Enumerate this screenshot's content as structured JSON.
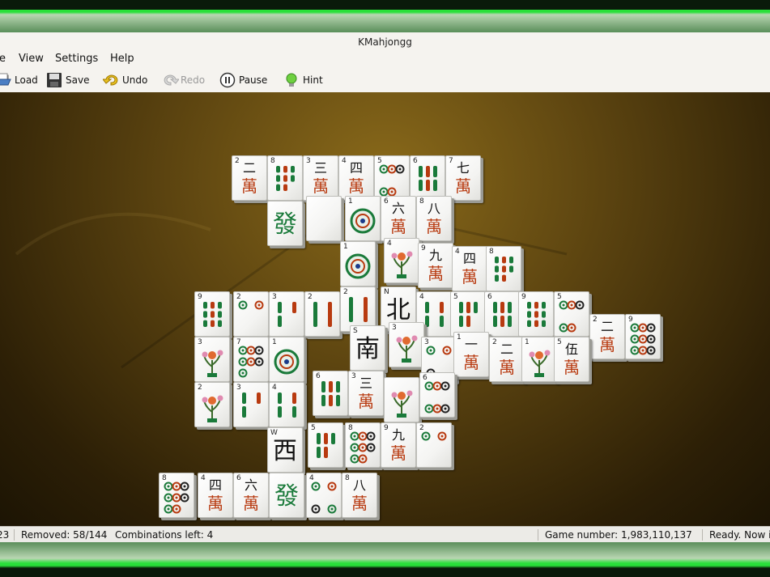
{
  "window": {
    "title": "KMahjongg"
  },
  "menu": [
    {
      "id": "game",
      "label": "e"
    },
    {
      "id": "view",
      "label": "View"
    },
    {
      "id": "settings",
      "label": "Settings"
    },
    {
      "id": "help",
      "label": "Help"
    }
  ],
  "toolbar": [
    {
      "id": "load",
      "label": "Load",
      "icon": "folder-open-icon",
      "enabled": true
    },
    {
      "id": "save",
      "label": "Save",
      "icon": "floppy-disk-icon",
      "enabled": true
    },
    {
      "id": "undo",
      "label": "Undo",
      "icon": "undo-arrow-icon",
      "enabled": true
    },
    {
      "id": "redo",
      "label": "Redo",
      "icon": "redo-arrow-icon",
      "enabled": false
    },
    {
      "id": "pause",
      "label": "Pause",
      "icon": "pause-icon",
      "enabled": true
    },
    {
      "id": "hint",
      "label": "Hint",
      "icon": "lightbulb-icon",
      "enabled": true
    }
  ],
  "status": {
    "time": "23",
    "removed": "Removed: 58/144",
    "combinations": "Combinations left: 4",
    "game_number": "Game number: 1,983,110,137",
    "message": "Ready. Now i"
  },
  "tiles": [
    {
      "n": "2",
      "k": "wan",
      "g": "二"
    },
    {
      "n": "8",
      "k": "bamboo"
    },
    {
      "n": "3",
      "k": "wan",
      "g": "三"
    },
    {
      "n": "4",
      "k": "wan",
      "g": "四"
    },
    {
      "n": "5",
      "k": "dots"
    },
    {
      "n": "6",
      "k": "bamboo"
    },
    {
      "n": "7",
      "k": "wan",
      "g": "七"
    },
    {
      "n": "",
      "k": "dragon",
      "g": "發"
    },
    {
      "n": "",
      "k": "blank"
    },
    {
      "n": "1",
      "k": "dots1"
    },
    {
      "n": "6",
      "k": "wan",
      "g": "六"
    },
    {
      "n": "8",
      "k": "wan",
      "g": "八"
    },
    {
      "n": "1",
      "k": "dots1"
    },
    {
      "n": "4",
      "k": "flower"
    },
    {
      "n": "9",
      "k": "wan",
      "g": "九"
    },
    {
      "n": "4",
      "k": "wan",
      "g": "四"
    },
    {
      "n": "8",
      "k": "bamboo"
    },
    {
      "n": "9",
      "k": "bamboo"
    },
    {
      "n": "2",
      "k": "dots"
    },
    {
      "n": "3",
      "k": "bamboo"
    },
    {
      "n": "2",
      "k": "bamboo"
    },
    {
      "n": "2",
      "k": "bamboo"
    },
    {
      "n": "N",
      "k": "wind",
      "g": "北"
    },
    {
      "n": "4",
      "k": "bamboo"
    },
    {
      "n": "5",
      "k": "bamboo"
    },
    {
      "n": "6",
      "k": "bamboo"
    },
    {
      "n": "9",
      "k": "bamboo"
    },
    {
      "n": "5",
      "k": "dots"
    },
    {
      "n": "2",
      "k": "wan",
      "g": "二"
    },
    {
      "n": "9",
      "k": "dots"
    },
    {
      "n": "3",
      "k": "flower"
    },
    {
      "n": "7",
      "k": "dots"
    },
    {
      "n": "1",
      "k": "dots1"
    },
    {
      "n": "S",
      "k": "wind",
      "g": "南"
    },
    {
      "n": "3",
      "k": "flower"
    },
    {
      "n": "3",
      "k": "dots"
    },
    {
      "n": "1",
      "k": "wan",
      "g": "一"
    },
    {
      "n": "2",
      "k": "wan",
      "g": "二"
    },
    {
      "n": "1",
      "k": "flower"
    },
    {
      "n": "5",
      "k": "wan",
      "g": "伍"
    },
    {
      "n": "2",
      "k": "flower"
    },
    {
      "n": "3",
      "k": "bamboo"
    },
    {
      "n": "4",
      "k": "bamboo"
    },
    {
      "n": "6",
      "k": "bamboo"
    },
    {
      "n": "3",
      "k": "wan",
      "g": "三"
    },
    {
      "n": "",
      "k": "flower"
    },
    {
      "n": "6",
      "k": "dots"
    },
    {
      "n": "W",
      "k": "wind",
      "g": "西"
    },
    {
      "n": "5",
      "k": "bamboo"
    },
    {
      "n": "8",
      "k": "dots"
    },
    {
      "n": "9",
      "k": "wan",
      "g": "九"
    },
    {
      "n": "2",
      "k": "dots"
    },
    {
      "n": "8",
      "k": "dots"
    },
    {
      "n": "4",
      "k": "wan",
      "g": "四"
    },
    {
      "n": "6",
      "k": "wan",
      "g": "六"
    },
    {
      "n": "",
      "k": "dragon",
      "g": "發"
    },
    {
      "n": "4",
      "k": "dots"
    },
    {
      "n": "8",
      "k": "wan",
      "g": "八"
    }
  ],
  "wan_char": "萬",
  "colors": {
    "accent_green": "#29e03a",
    "wan_red": "#b83a10",
    "dragon_green": "#1a7a3a"
  }
}
